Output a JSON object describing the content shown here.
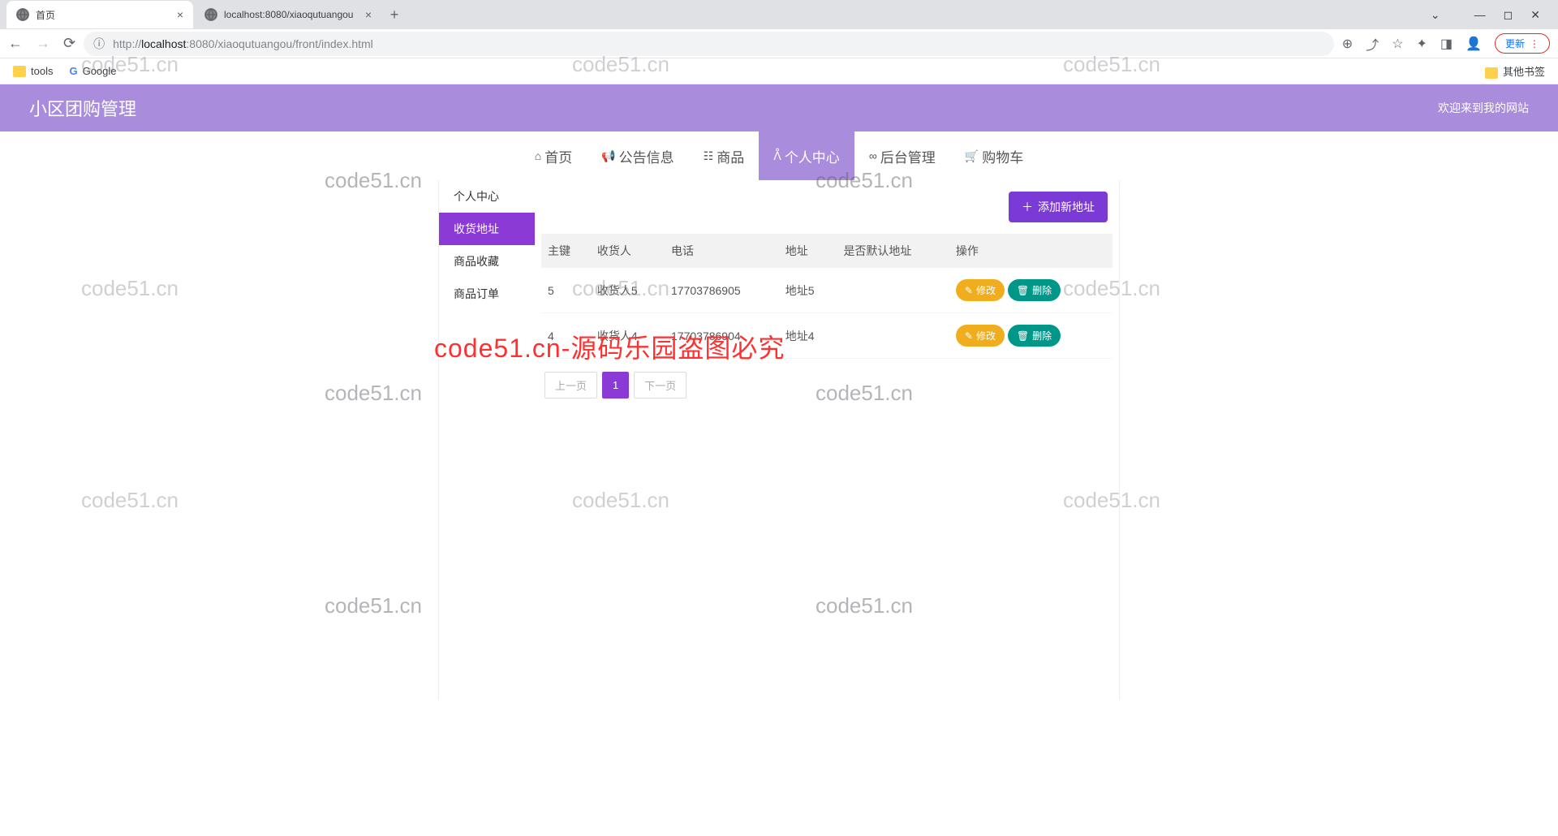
{
  "browser": {
    "tabs": [
      {
        "title": "首页",
        "active": true
      },
      {
        "title": "localhost:8080/xiaoqutuangou",
        "active": false
      }
    ],
    "url_prefix": "http://",
    "url_host": "localhost",
    "url_port": ":8080",
    "url_path": "/xiaoqutuangou/front/index.html",
    "update_label": "更新",
    "bookmarks": {
      "tools": "tools",
      "google": "Google",
      "other": "其他书签"
    }
  },
  "header": {
    "title": "小区团购管理",
    "welcome": "欢迎来到我的网站"
  },
  "nav": [
    {
      "label": "首页",
      "icon": "home"
    },
    {
      "label": "公告信息",
      "icon": "bullhorn"
    },
    {
      "label": "商品",
      "icon": "box"
    },
    {
      "label": "个人中心",
      "icon": "user",
      "active": true
    },
    {
      "label": "后台管理",
      "icon": "link"
    },
    {
      "label": "购物车",
      "icon": "cart"
    }
  ],
  "sidebar": {
    "heading": "个人中心",
    "items": [
      {
        "label": "收货地址",
        "active": true
      },
      {
        "label": "商品收藏"
      },
      {
        "label": "商品订单"
      }
    ]
  },
  "actions": {
    "add": "添加新地址",
    "edit": "修改",
    "delete": "删除"
  },
  "table": {
    "headers": [
      "主键",
      "收货人",
      "电话",
      "地址",
      "是否默认地址",
      "操作"
    ],
    "rows": [
      {
        "id": "5",
        "name": "收货人5",
        "phone": "17703786905",
        "addr": "地址5",
        "def": ""
      },
      {
        "id": "4",
        "name": "收货人4",
        "phone": "17703786904",
        "addr": "地址4",
        "def": ""
      }
    ]
  },
  "pager": {
    "prev": "上一页",
    "current": "1",
    "next": "下一页"
  },
  "watermarks": {
    "text": "code51.cn",
    "red": "code51.cn-源码乐园盗图必究"
  }
}
